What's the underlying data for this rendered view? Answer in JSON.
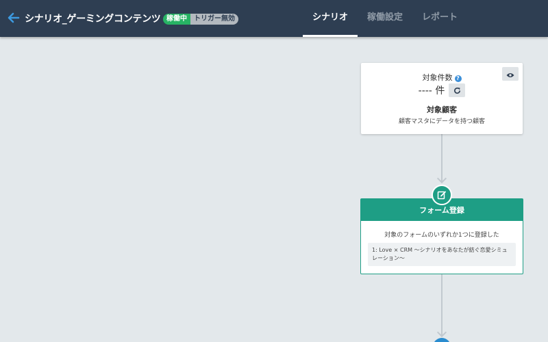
{
  "header": {
    "title": "シナリオ_ゲーミングコンテンツ",
    "status_badge": "稼働中",
    "trigger_badge": "トリガー無効",
    "tabs": [
      {
        "label": "シナリオ",
        "selected": true
      },
      {
        "label": "稼働設定",
        "selected": false
      },
      {
        "label": "レポート",
        "selected": false
      }
    ],
    "back_icon": "arrow-left-icon"
  },
  "target_card": {
    "count_label": "対象件数",
    "help_glyph": "?",
    "count_value": "---- 件",
    "title": "対象顧客",
    "description": "顧客マスタにデータを持つ顧客"
  },
  "form_card": {
    "title": "フォーム登録",
    "description": "対象のフォームのいずれか1つに登録した",
    "item": "1: Love × CRM 〜シナリオをあなたが紡ぐ恋愛シミュレーション〜"
  },
  "colors": {
    "header_bg": "#2e3e52",
    "canvas_bg": "#e3e8eb",
    "active_badge": "#27b364",
    "form_accent": "#1e9e85",
    "help_icon": "#3b8fd9"
  }
}
